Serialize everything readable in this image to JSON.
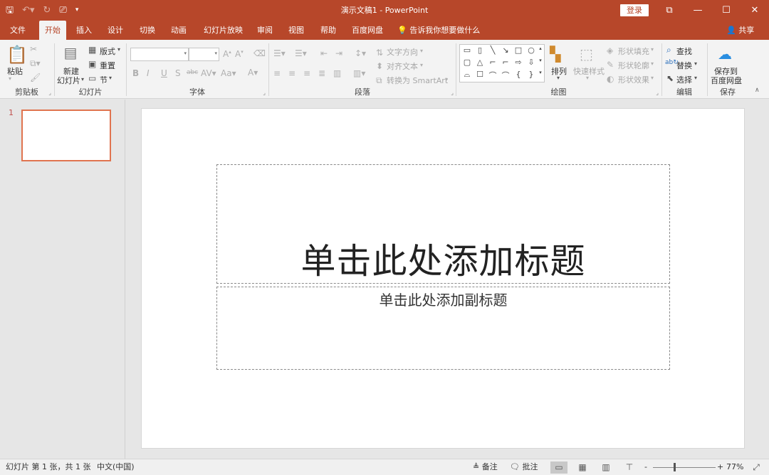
{
  "app": {
    "doc_title": "演示文稿1  -  PowerPoint",
    "login": "登录",
    "share": "共享",
    "accent": "#b7472a"
  },
  "qat": {
    "save_icon": "save-icon",
    "undo_icon": "undo-icon",
    "redo_icon": "redo-icon",
    "present_icon": "present-from-beginning-icon",
    "customize_icon": "customize-qat-icon"
  },
  "tabs": [
    "文件",
    "开始",
    "插入",
    "设计",
    "切换",
    "动画",
    "幻灯片放映",
    "审阅",
    "视图",
    "帮助",
    "百度网盘"
  ],
  "tell_me": "告诉我你想要做什么",
  "ribbon": {
    "clipboard": {
      "label": "剪贴板",
      "paste": "粘贴"
    },
    "slides": {
      "label": "幻灯片",
      "new_slide_1": "新建",
      "new_slide_2": "幻灯片",
      "layout": "版式",
      "reset": "重置",
      "section": "节"
    },
    "font": {
      "label": "字体"
    },
    "paragraph": {
      "label": "段落",
      "text_direction": "文字方向",
      "align_text": "对齐文本",
      "smartart": "转换为 SmartArt"
    },
    "drawing": {
      "label": "绘图",
      "arrange": "排列",
      "quick_styles": "快速样式",
      "shape_fill": "形状填充",
      "shape_outline": "形状轮廓",
      "shape_effects": "形状效果"
    },
    "editing": {
      "label": "编辑",
      "find": "查找",
      "replace": "替换",
      "select": "选择"
    },
    "save": {
      "label": "保存",
      "save_to_1": "保存到",
      "save_to_2": "百度网盘"
    }
  },
  "slides_panel": {
    "slide_number": "1"
  },
  "slide": {
    "title_placeholder": "单击此处添加标题",
    "subtitle_placeholder": "单击此处添加副标题"
  },
  "status": {
    "slide_info": "幻灯片 第 1 张，共 1 张",
    "language": "中文(中国)",
    "notes": "备注",
    "comments": "批注",
    "zoom_minus": "-",
    "zoom_plus": "+",
    "zoom": "77%",
    "zoom_level_percent": 77
  }
}
